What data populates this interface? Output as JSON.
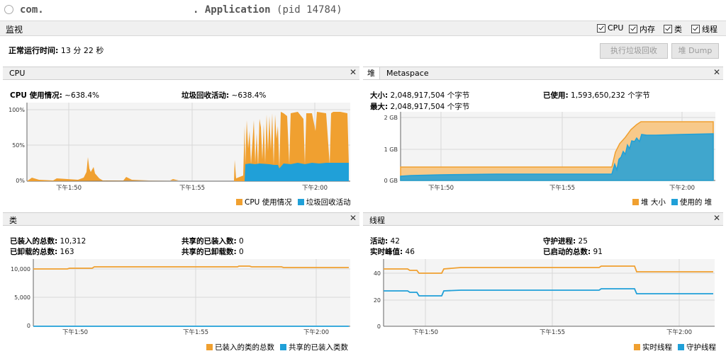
{
  "window": {
    "title_left": "com.",
    "title_app": ". Application",
    "title_pid": "(pid 14784)"
  },
  "monitor": {
    "label": "监视",
    "checkboxes": [
      "CPU",
      "内存",
      "类",
      "线程"
    ]
  },
  "uptime": {
    "label": "正常运行时间:",
    "value": "13 分 22 秒"
  },
  "buttons": {
    "gc": "执行垃圾回收",
    "heap_dump": "堆 Dump"
  },
  "colors": {
    "orange": "#f0a030",
    "blue": "#20a0d8",
    "grid": "#d8d8d8"
  },
  "cpu": {
    "title": "CPU",
    "usage_label": "CPU 使用情况:",
    "usage_value": "~638.4%",
    "gc_label": "垃圾回收活动:",
    "gc_value": "~638.4%",
    "legend": [
      "CPU 使用情况",
      "垃圾回收活动"
    ],
    "y_ticks": [
      "100%",
      "50%",
      "0%"
    ],
    "x_ticks": [
      "下午1:50",
      "下午1:55",
      "下午2:00"
    ]
  },
  "heap": {
    "tab_heap": "堆",
    "tab_meta": "Metaspace",
    "size_label": "大小:",
    "size_value": "2,048,917,504 个字节",
    "max_label": "最大:",
    "max_value": "2,048,917,504 个字节",
    "used_label": "已使用:",
    "used_value": "1,593,650,232 个字节",
    "legend": [
      "堆 大小",
      "使用的 堆"
    ],
    "y_ticks": [
      "2 GB",
      "1 GB",
      "0 GB"
    ],
    "x_ticks": [
      "下午1:50",
      "下午1:55",
      "下午2:00"
    ]
  },
  "classes": {
    "title": "类",
    "loaded_label": "已装入的总数:",
    "loaded_value": "10,312",
    "unloaded_label": "已卸载的总数:",
    "unloaded_value": "163",
    "shared_loaded_label": "共享的已装入数:",
    "shared_loaded_value": "0",
    "shared_unloaded_label": "共享的已卸载数:",
    "shared_unloaded_value": "0",
    "legend": [
      "已装入的类的总数",
      "共享的已装入类数"
    ],
    "y_ticks": [
      "10,000",
      "5,000",
      "0"
    ],
    "x_ticks": [
      "下午1:50",
      "下午1:55",
      "下午2:00"
    ]
  },
  "threads": {
    "title": "线程",
    "live_label": "活动:",
    "live_value": "42",
    "peak_label": "实时峰值:",
    "peak_value": "46",
    "daemon_label": "守护进程:",
    "daemon_value": "25",
    "started_label": "已启动的总数:",
    "started_value": "91",
    "legend": [
      "实时线程",
      "守护线程"
    ],
    "y_ticks": [
      "40",
      "20",
      "0"
    ],
    "x_ticks": [
      "下午1:50",
      "下午1:55",
      "下午2:00"
    ]
  }
}
